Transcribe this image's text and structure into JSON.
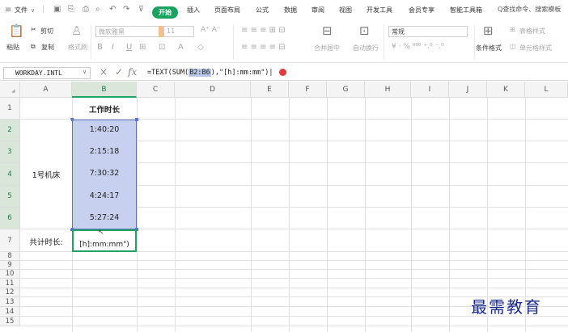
{
  "menu": {
    "file": "文件",
    "tabs": [
      "开始",
      "插入",
      "页面布局",
      "公式",
      "数据",
      "审阅",
      "视图",
      "开发工具",
      "会员专享",
      "智能工具箱"
    ],
    "search": "Q查找命令、搜索模板"
  },
  "ribbon": {
    "cut": "剪切",
    "paste": "粘贴",
    "copy": "复制",
    "format_painter": "格式刷",
    "font_name": "微软雅黑",
    "font_size": "11",
    "merge_center": "合并居中",
    "auto_wrap": "自动换行",
    "number_format": "常规",
    "conditional_format": "条件格式",
    "table_style": "表格样式",
    "cell_style": "单元格样式"
  },
  "formula_bar": {
    "name_box": "WORKDAY.INTL",
    "fx": "fx",
    "formula_pre": "=TEXT(SUM(",
    "formula_ref": "B2:B6",
    "formula_post": "),\"[h]:mm:mm\")|"
  },
  "grid": {
    "columns": [
      "A",
      "B",
      "C",
      "D",
      "E",
      "F",
      "G",
      "H",
      "I",
      "J",
      "K",
      "L"
    ],
    "rows": [
      "1",
      "2",
      "3",
      "4",
      "5",
      "6",
      "7",
      "8",
      "9",
      "10",
      "11",
      "12",
      "13",
      "14",
      "15"
    ],
    "header_b1": "工作时长",
    "times": [
      "1:40:20",
      "2:15:18",
      "7:30:32",
      "4:24:17",
      "5:27:24"
    ],
    "machine_label": "1号机床",
    "total_label": "共计时长:",
    "editing_text": "[h]:mm:mm\")"
  },
  "watermark": "最需教育"
}
